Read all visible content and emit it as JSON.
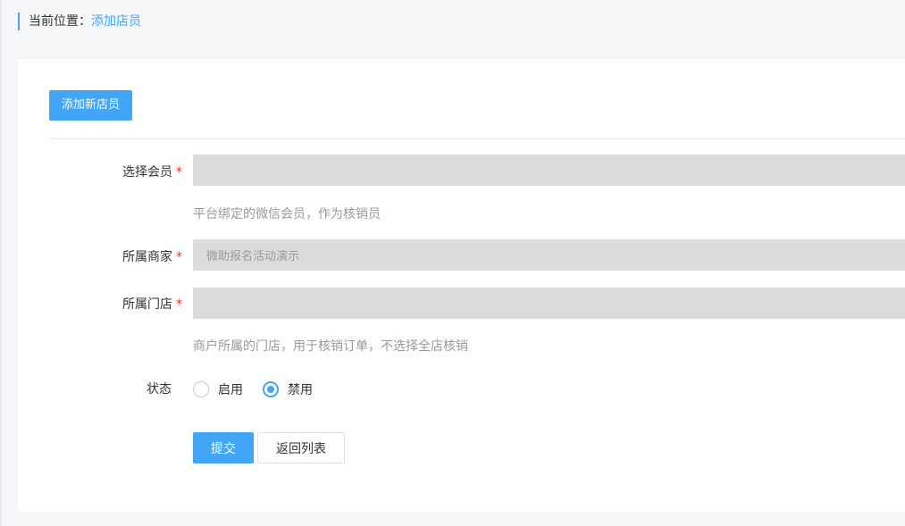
{
  "breadcrumb": {
    "label": "当前位置：",
    "current": "添加店员"
  },
  "panel": {
    "add_button_label": "添加新店员"
  },
  "form": {
    "member": {
      "label": "选择会员",
      "required_mark": "*",
      "value": "",
      "hint": "平台绑定的微信会员，作为核销员"
    },
    "merchant": {
      "label": "所属商家",
      "required_mark": "*",
      "value": "微助报名活动演示"
    },
    "store": {
      "label": "所属门店",
      "required_mark": "*",
      "value": "",
      "hint": "商户所属的门店，用于核销订单，不选择全店核销"
    },
    "status": {
      "label": "状态",
      "options": [
        {
          "label": "启用",
          "checked": false
        },
        {
          "label": "禁用",
          "checked": true
        }
      ]
    }
  },
  "actions": {
    "submit_label": "提交",
    "back_label": "返回列表"
  },
  "colors": {
    "accent": "#42a5f5",
    "required": "#e53935",
    "field_bg": "#dcdcdc"
  }
}
